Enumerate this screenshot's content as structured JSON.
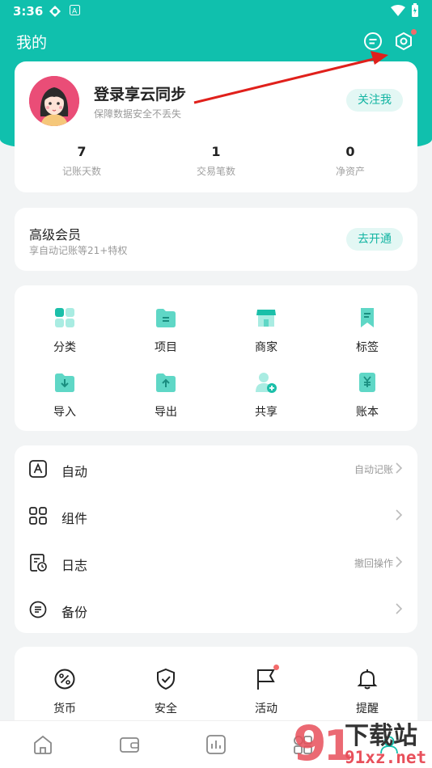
{
  "status": {
    "time": "3:36"
  },
  "header": {
    "title": "我的"
  },
  "profile": {
    "name": "登录享云同步",
    "subtitle": "保障数据安全不丢失",
    "follow_label": "关注我",
    "stats": [
      {
        "value": "7",
        "label": "记账天数"
      },
      {
        "value": "1",
        "label": "交易笔数"
      },
      {
        "value": "0",
        "label": "净资产"
      }
    ]
  },
  "vip": {
    "title": "高级会员",
    "subtitle": "享自动记账等21+特权",
    "button": "去开通"
  },
  "grid": {
    "items": [
      {
        "label": "分类",
        "icon": "category-icon"
      },
      {
        "label": "项目",
        "icon": "folder-icon"
      },
      {
        "label": "商家",
        "icon": "store-icon"
      },
      {
        "label": "标签",
        "icon": "tag-icon"
      },
      {
        "label": "导入",
        "icon": "import-icon"
      },
      {
        "label": "导出",
        "icon": "export-icon"
      },
      {
        "label": "共享",
        "icon": "share-user-icon"
      },
      {
        "label": "账本",
        "icon": "ledger-icon"
      }
    ]
  },
  "list": {
    "items": [
      {
        "label": "自动",
        "hint": "自动记账",
        "icon": "auto-icon"
      },
      {
        "label": "组件",
        "hint": "",
        "icon": "widget-icon"
      },
      {
        "label": "日志",
        "hint": "撤回操作",
        "icon": "log-icon"
      },
      {
        "label": "备份",
        "hint": "",
        "icon": "backup-icon"
      }
    ]
  },
  "tools": {
    "items": [
      {
        "label": "货币",
        "icon": "currency-icon"
      },
      {
        "label": "安全",
        "icon": "security-shield-icon"
      },
      {
        "label": "活动",
        "icon": "flag-icon"
      },
      {
        "label": "提醒",
        "icon": "bell-icon"
      }
    ]
  },
  "watermark": {
    "text": "下载站",
    "url_text": "91xz.net"
  },
  "colors": {
    "accent": "#10c0ad",
    "pill_bg": "#e3f7f4",
    "pill_text": "#12b4a2",
    "icon_teal": "#5fd7c6",
    "dot_red": "#f36b6b",
    "arrow_red": "#e0201b"
  }
}
